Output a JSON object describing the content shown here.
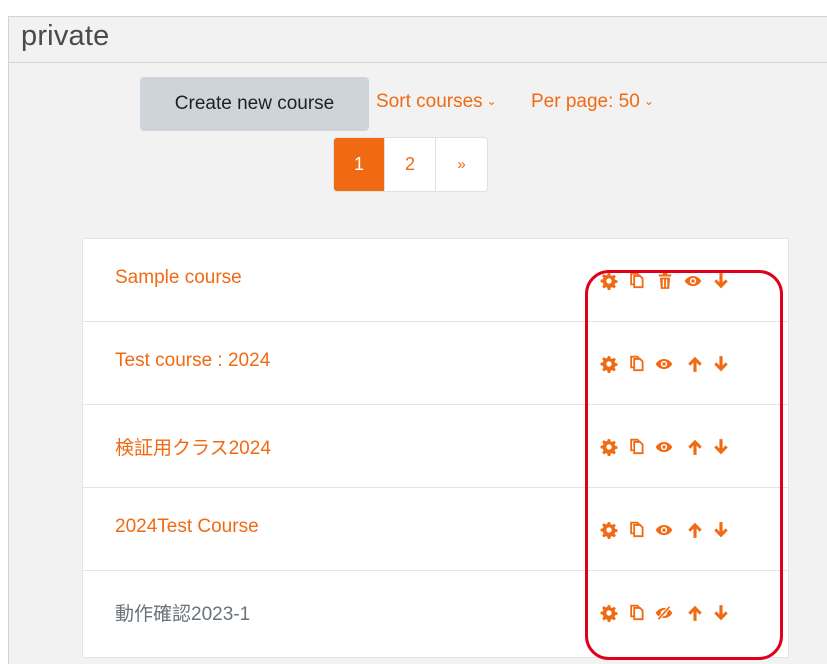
{
  "category": {
    "title": "private"
  },
  "toolbar": {
    "create_label": "Create new course",
    "sort_label": "Sort courses",
    "perpage_label": "Per page: 50"
  },
  "pagination": {
    "pages": [
      "1",
      "2"
    ],
    "current": "1",
    "next": "»"
  },
  "courses": [
    {
      "name": "Sample course",
      "visible": true,
      "actions": [
        "gear-icon",
        "copy-icon",
        "trash-icon",
        "eye-icon",
        "arrow-down-icon"
      ]
    },
    {
      "name": "Test course : 2024",
      "visible": true,
      "actions": [
        "gear-icon",
        "copy-icon",
        "eye-icon",
        "arrow-up-icon",
        "arrow-down-icon"
      ]
    },
    {
      "name": "検証用クラス2024",
      "visible": true,
      "actions": [
        "gear-icon",
        "copy-icon",
        "eye-icon",
        "arrow-up-icon",
        "arrow-down-icon"
      ]
    },
    {
      "name": "2024Test Course",
      "visible": true,
      "actions": [
        "gear-icon",
        "copy-icon",
        "eye-icon",
        "arrow-up-icon",
        "arrow-down-icon"
      ]
    },
    {
      "name": "動作確認2023-1",
      "visible": false,
      "actions": [
        "gear-icon",
        "copy-icon",
        "eye-slash-icon",
        "arrow-up-icon",
        "arrow-down-icon"
      ]
    }
  ],
  "colors": {
    "accent": "#f06a13",
    "highlight": "#e0001b",
    "muted_text": "#6a737b"
  }
}
